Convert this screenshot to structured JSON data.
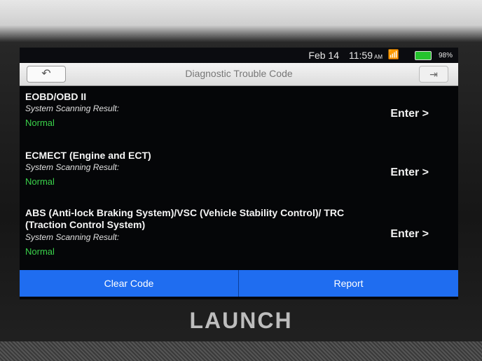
{
  "status_bar": {
    "date": "Feb 14",
    "time": "11:59",
    "ampm": "AM",
    "battery": "98%",
    "icons": [
      "wifi-icon",
      "battery-icon"
    ]
  },
  "header": {
    "title": "Diagnostic Trouble Code",
    "back_icon": "back-arrow-icon",
    "exit_icon": "exit-icon"
  },
  "systems": [
    {
      "name": "EOBD/OBD II",
      "scan_label": "System Scanning Result:",
      "result": "Normal",
      "action": "Enter >"
    },
    {
      "name": "ECMECT (Engine and ECT)",
      "scan_label": "System Scanning Result:",
      "result": "Normal",
      "action": "Enter >"
    },
    {
      "name": "ABS (Anti-lock Braking System)/VSC (Vehicle Stability Control)/ TRC (Traction Control System)",
      "scan_label": "System Scanning Result:",
      "result": "Normal",
      "action": "Enter >"
    }
  ],
  "footer": {
    "clear_code": "Clear Code",
    "report": "Report"
  },
  "device_brand": "LAUNCH",
  "colors": {
    "accent": "#1f6df0",
    "normal_status": "#3ad24a"
  }
}
